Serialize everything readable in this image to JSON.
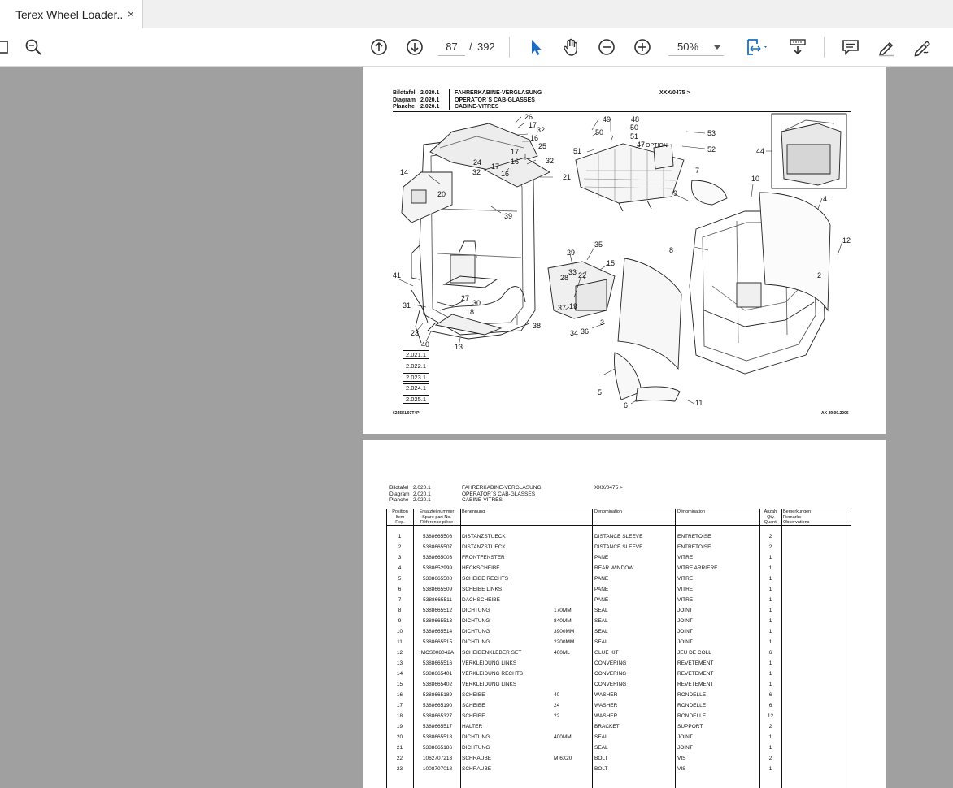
{
  "tab": {
    "title": "Terex Wheel Loader...",
    "close": "×"
  },
  "toolbar": {
    "page_current": "87",
    "page_sep": "/",
    "page_total": "392",
    "zoom": "50%"
  },
  "page1": {
    "header": {
      "labels": [
        "Bildtafel",
        "Diagram",
        "Planche"
      ],
      "numbers": [
        "2.020.1",
        "2.020.1",
        "2.020.1"
      ],
      "titles": [
        "FAHRERKABINE-VERGLASUNG",
        "OPERATOR`S CAB-GLASSES",
        "CABINE-VITRES"
      ],
      "serial": "XXX/0475 >"
    },
    "callouts": [
      "26",
      "17",
      "32",
      "16",
      "25",
      "17",
      "16",
      "32",
      "24",
      "32",
      "17",
      "16",
      "21",
      "14",
      "20",
      "39",
      "49",
      "48",
      "50",
      "50",
      "51",
      "51",
      "47",
      "OPTION",
      "53",
      "52",
      "44",
      "7",
      "9",
      "10",
      "4",
      "12",
      "8",
      "2",
      "29",
      "35",
      "15",
      "33",
      "22",
      "28",
      "19",
      "37",
      "36",
      "34",
      "38",
      "3",
      "41",
      "31",
      "27",
      "30",
      "18",
      "23",
      "40",
      "13",
      "5",
      "6",
      "11"
    ],
    "ref_boxes": [
      "2.021.1",
      "2.022.1",
      "2.023.1",
      "2.024.1",
      "2.025.1"
    ],
    "footer_left": "6245KL03T4P",
    "footer_right": "AK 29.09.2006"
  },
  "page2": {
    "header": {
      "labels": [
        "Bildtafel",
        "Diagram",
        "Planche"
      ],
      "numbers": [
        "2.020.1",
        "2.020.1",
        "2.020.1"
      ],
      "titles": [
        "FAHRERKABINE-VERGLASUNG",
        "OPERATOR`S CAB-GLASSES",
        "CABINE-VITRES"
      ],
      "serial": "XXX/0475 >"
    },
    "columns": {
      "position": [
        "Position",
        "Item",
        "Rep."
      ],
      "part_no": [
        "Ersatzteilnummer",
        "Spare part No.",
        "Référence pièce"
      ],
      "benennung": [
        "Benennung"
      ],
      "denomination_en": [
        "Denomination"
      ],
      "denomination_fr": [
        "Dénomination"
      ],
      "qty": [
        "Anzahl",
        "Qty.",
        "Quant."
      ],
      "remarks": [
        "Bemerkungen",
        "Remarks",
        "Observations"
      ]
    },
    "rows": [
      {
        "pos": "1",
        "part": "5388665506",
        "de": "DISTANZSTUECK",
        "spec": "",
        "en": "DISTANCE SLEEVE",
        "fr": "ENTRETOISE",
        "qty": "2"
      },
      {
        "pos": "2",
        "part": "5388665507",
        "de": "DISTANZSTUECK",
        "spec": "",
        "en": "DISTANCE SLEEVE",
        "fr": "ENTRETOISE",
        "qty": "2"
      },
      {
        "pos": "3",
        "part": "5388665003",
        "de": "FRONTFENSTER",
        "spec": "",
        "en": "PANE",
        "fr": "VITRE",
        "qty": "1"
      },
      {
        "pos": "4",
        "part": "5388652999",
        "de": "HECKSCHEIBE",
        "spec": "",
        "en": "REAR WINDOW",
        "fr": "VITRE ARRIERE",
        "qty": "1"
      },
      {
        "pos": "5",
        "part": "5388665508",
        "de": "SCHEIBE RECHTS",
        "spec": "",
        "en": "PANE",
        "fr": "VITRE",
        "qty": "1"
      },
      {
        "pos": "6",
        "part": "5388665509",
        "de": "SCHEIBE LINKS",
        "spec": "",
        "en": "PANE",
        "fr": "VITRE",
        "qty": "1"
      },
      {
        "pos": "7",
        "part": "5388665511",
        "de": "DACHSCHEIBE",
        "spec": "",
        "en": "PANE",
        "fr": "VITRE",
        "qty": "1"
      },
      {
        "pos": "8",
        "part": "5388665512",
        "de": "DICHTUNG",
        "spec": "170MM",
        "en": "SEAL",
        "fr": "JOINT",
        "qty": "1"
      },
      {
        "pos": "9",
        "part": "5388665513",
        "de": "DICHTUNG",
        "spec": "840MM",
        "en": "SEAL",
        "fr": "JOINT",
        "qty": "1"
      },
      {
        "pos": "10",
        "part": "5388665514",
        "de": "DICHTUNG",
        "spec": "3900MM",
        "en": "SEAL",
        "fr": "JOINT",
        "qty": "1"
      },
      {
        "pos": "11",
        "part": "5388665515",
        "de": "DICHTUNG",
        "spec": "2200MM",
        "en": "SEAL",
        "fr": "JOINT",
        "qty": "1"
      },
      {
        "pos": "12",
        "part": "MCS008042A",
        "de": "SCHEIBENKLEBER SET",
        "spec": "400ML",
        "en": "GLUE KIT",
        "fr": "JEU DE COLL",
        "qty": "6"
      },
      {
        "pos": "13",
        "part": "5388665516",
        "de": "VERKLEIDUNG LINKS",
        "spec": "",
        "en": "CONVERING",
        "fr": "REVETEMENT",
        "qty": "1"
      },
      {
        "pos": "14",
        "part": "5388665401",
        "de": "VERKLEIDUNG RECHTS",
        "spec": "",
        "en": "CONVERING",
        "fr": "REVETEMENT",
        "qty": "1"
      },
      {
        "pos": "15",
        "part": "5388665402",
        "de": "VERKLEIDUNG LINKS",
        "spec": "",
        "en": "CONVERING",
        "fr": "REVETEMENT",
        "qty": "1"
      },
      {
        "pos": "16",
        "part": "5388665189",
        "de": "SCHEIBE",
        "spec": "40",
        "en": "WASHER",
        "fr": "RONDELLE",
        "qty": "6"
      },
      {
        "pos": "17",
        "part": "5388665190",
        "de": "SCHEIBE",
        "spec": "24",
        "en": "WASHER",
        "fr": "RONDELLE",
        "qty": "6"
      },
      {
        "pos": "18",
        "part": "5388665327",
        "de": "SCHEIBE",
        "spec": "22",
        "en": "WASHER",
        "fr": "RONDELLE",
        "qty": "12"
      },
      {
        "pos": "19",
        "part": "5388665517",
        "de": "HALTER",
        "spec": "",
        "en": "BRACKET",
        "fr": "SUPPORT",
        "qty": "2"
      },
      {
        "pos": "20",
        "part": "5388665518",
        "de": "DICHTUNG",
        "spec": "400MM",
        "en": "SEAL",
        "fr": "JOINT",
        "qty": "1"
      },
      {
        "pos": "21",
        "part": "5388665186",
        "de": "DICHTUNG",
        "spec": "",
        "en": "SEAL",
        "fr": "JOINT",
        "qty": "1"
      },
      {
        "pos": "22",
        "part": "1062707213",
        "de": "SCHRAUBE",
        "spec": "M 6X20",
        "en": "BOLT",
        "fr": "VIS",
        "qty": "2"
      },
      {
        "pos": "23",
        "part": "1008707018",
        "de": "SCHRAUBE",
        "spec": "",
        "en": "BOLT",
        "fr": "VIS",
        "qty": "1"
      }
    ]
  }
}
